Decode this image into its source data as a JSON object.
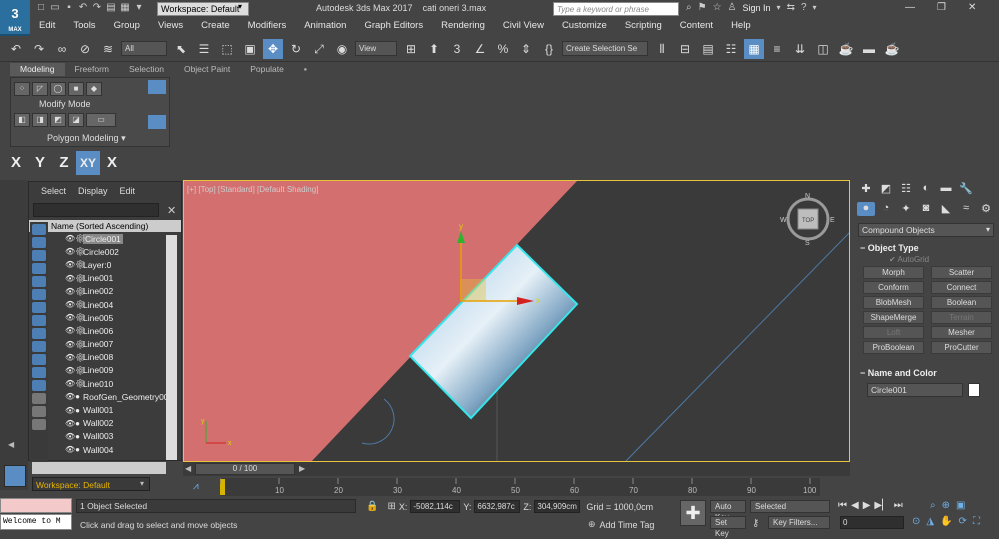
{
  "titlebar": {
    "logo_text": "3",
    "logo_sub": "MAX",
    "workspace": "Workspace: Default",
    "app_title": "Autodesk 3ds Max 2017",
    "file_name": "cati oneri 3.max",
    "search_placeholder": "Type a keyword or phrase",
    "sign_in": "Sign In"
  },
  "menu": [
    "Edit",
    "Tools",
    "Group",
    "Views",
    "Create",
    "Modifiers",
    "Animation",
    "Graph Editors",
    "Rendering",
    "Civil View",
    "Customize",
    "Scripting",
    "Content",
    "Help"
  ],
  "toolbar": {
    "filter_value": "All",
    "view_value": "View",
    "selection_set_placeholder": "Create Selection Se"
  },
  "ribbon": {
    "tabs": [
      "Modeling",
      "Freeform",
      "Selection",
      "Object Paint",
      "Populate"
    ],
    "active_tab": "Modeling",
    "modify_mode": "Modify Mode",
    "polygon_modeling": "Polygon Modeling"
  },
  "axis_constraints": [
    "X",
    "Y",
    "Z",
    "XY",
    "X"
  ],
  "scene_explorer": {
    "menu": [
      "Select",
      "Display",
      "Edit"
    ],
    "column_header": "Name (Sorted Ascending)",
    "items": [
      "Circle001",
      "Circle002",
      "Layer:0",
      "Line001",
      "Line002",
      "Line004",
      "Line005",
      "Line006",
      "Line007",
      "Line008",
      "Line009",
      "Line010",
      "RoofGen_Geometry00",
      "Wall001",
      "Wall002",
      "Wall003",
      "Wall004"
    ],
    "selected": "Circle001"
  },
  "workspace_bottom": "Workspace: Default",
  "viewport": {
    "label": "[+] [Top] [Standard] [Default Shading]",
    "viewcube_label": "TOP",
    "compass": [
      "N",
      "W",
      "E",
      "S"
    ],
    "gizmo_axes": [
      "y",
      "x"
    ]
  },
  "command_panel": {
    "category": "Compound Objects",
    "object_type_title": "Object Type",
    "autogrid": "AutoGrid",
    "buttons": [
      {
        "label": "Morph",
        "enabled": true
      },
      {
        "label": "Scatter",
        "enabled": true
      },
      {
        "label": "Conform",
        "enabled": true
      },
      {
        "label": "Connect",
        "enabled": true
      },
      {
        "label": "BlobMesh",
        "enabled": true
      },
      {
        "label": "Boolean",
        "enabled": true
      },
      {
        "label": "ShapeMerge",
        "enabled": true
      },
      {
        "label": "Terrain",
        "enabled": false
      },
      {
        "label": "Loft",
        "enabled": false
      },
      {
        "label": "Mesher",
        "enabled": true
      },
      {
        "label": "ProBoolean",
        "enabled": true
      },
      {
        "label": "ProCutter",
        "enabled": true
      }
    ],
    "name_color_title": "Name and Color",
    "object_name": "Circle001",
    "object_color": "#ffffff"
  },
  "timeline": {
    "frame": "0 / 100",
    "ticks": [
      "10",
      "20",
      "30",
      "40",
      "50",
      "60",
      "70",
      "80",
      "90",
      "100"
    ]
  },
  "status": {
    "maxscript_text": "Welcome to M",
    "selected": "1 Object Selected",
    "prompt": "Click and drag to select and move objects",
    "x_label": "X:",
    "x_value": "-5082,114c",
    "y_label": "Y:",
    "y_value": "6632,987c",
    "z_label": "Z:",
    "z_value": "304,909cm",
    "grid": "Grid = 1000,0cm",
    "add_time_tag": "Add Time Tag",
    "auto_key": "Auto Key",
    "set_key": "Set Key",
    "key_mode": "Selected",
    "key_filters": "Key Filters...",
    "current_frame": "0"
  },
  "colors": {
    "accent": "#5a8dc4",
    "viewport_bg": "#3a3a3a",
    "pink_region": "#d46f6f",
    "selection_cyan": "#37e5ea",
    "viewport_border": "#e8c43a"
  }
}
